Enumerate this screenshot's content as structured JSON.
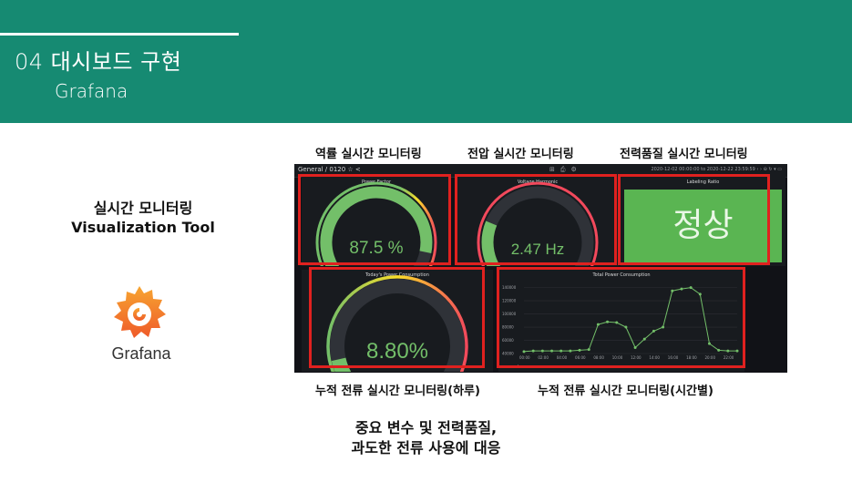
{
  "header": {
    "title": "04 대시보드 구현",
    "subtitle": "Grafana"
  },
  "labels": {
    "top1": "역률 실시간 모니터링",
    "top2": "전압 실시간 모니터링",
    "top3": "전력품질 실시간 모니터링",
    "bottom1": "누적 전류 실시간 모니터링(하루)",
    "bottom2": "누적 전류 실시간 모니터링(시간별)"
  },
  "left": {
    "title_line1": "실시간 모니터링",
    "title_line2": "Visualization Tool",
    "logo_text": "Grafana"
  },
  "dashboard": {
    "breadcrumb": "General / 0120 ☆ <",
    "time_range": "2020-12-02 00:00:00 to 2020-12-22 23:59:59 ‹ › ⊖ ↻ ▾ ▭",
    "panels": {
      "power_factor": {
        "title": "Power Factor",
        "value": "87.5 %",
        "fraction": 0.875
      },
      "voltage_harmonic": {
        "title": "Voltage Harmonic",
        "value": "2.47 Hz",
        "fraction": 0.25
      },
      "labeling_ratio": {
        "title": "Labeling Ratio",
        "value": "정상"
      },
      "todays_power": {
        "title": "Today's Power Consumption",
        "value": "8.80%",
        "fraction": 0.12
      },
      "total_power": {
        "title": "Total Power Consumption",
        "legend": "value",
        "y_ticks": [
          "140000",
          "120000",
          "100000",
          "80000",
          "60000",
          "40000"
        ],
        "x_ticks": [
          "00:00",
          "02:00",
          "04:00",
          "06:00",
          "08:00",
          "10:00",
          "12:00",
          "14:00",
          "16:00",
          "18:00",
          "20:00",
          "22:00"
        ]
      }
    }
  },
  "bottom": {
    "line1": "중요 변수 및 전력품질,",
    "line2": "과도한 전류 사용에 대응"
  },
  "colors": {
    "header": "#168a72",
    "accent_green": "#73bf69",
    "red_box": "#e0211f",
    "dash_bg": "#111217",
    "panel_bg": "#181b1f"
  },
  "chart_data": {
    "type": "line",
    "title": "Total Power Consumption",
    "categories": [
      "00:00",
      "01:00",
      "02:00",
      "03:00",
      "04:00",
      "05:00",
      "06:00",
      "07:00",
      "08:00",
      "09:00",
      "10:00",
      "11:00",
      "12:00",
      "13:00",
      "14:00",
      "15:00",
      "16:00",
      "17:00",
      "18:00",
      "19:00",
      "20:00",
      "21:00",
      "22:00",
      "23:00"
    ],
    "series": [
      {
        "name": "value",
        "values": [
          43000,
          44000,
          44000,
          44000,
          44000,
          44000,
          45000,
          46000,
          84000,
          88000,
          87000,
          80000,
          49000,
          62000,
          74000,
          80000,
          135000,
          138000,
          140000,
          130000,
          55000,
          45000,
          44000,
          44000
        ]
      }
    ],
    "ylim": [
      40000,
      145000
    ],
    "grid": true,
    "legend": "bottom-left"
  }
}
